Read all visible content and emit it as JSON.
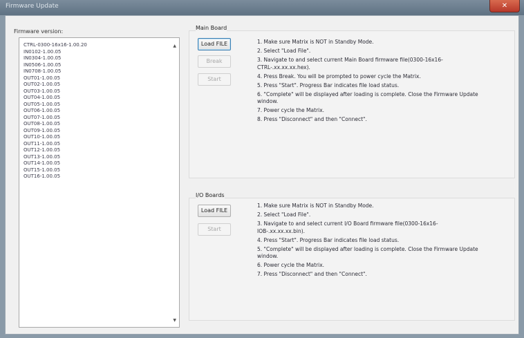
{
  "window": {
    "title": "Firmware Update",
    "close_glyph": "✕"
  },
  "firmware_version": {
    "label": "Firmware version:",
    "items": [
      "CTRL-0300-16x16-1.00.20",
      "IN0102-1.00.05",
      "IN0304-1.00.05",
      "IN0506-1.00.05",
      "IN0708-1.00.05",
      "OUT01-1.00.05",
      "OUT02-1.00.05",
      "OUT03-1.00.05",
      "OUT04-1.00.05",
      "OUT05-1.00.05",
      "OUT06-1.00.05",
      "OUT07-1.00.05",
      "OUT08-1.00.05",
      "OUT09-1.00.05",
      "OUT10-1.00.05",
      "OUT11-1.00.05",
      "OUT12-1.00.05",
      "OUT13-1.00.05",
      "OUT14-1.00.05",
      "OUT15-1.00.05",
      "OUT16-1.00.05"
    ]
  },
  "main_board": {
    "title": "Main Board",
    "load_label": "Load FILE",
    "break_label": "Break",
    "start_label": "Start",
    "steps": [
      "1. Make sure Matrix is NOT in Standby Mode.",
      "2. Select \"Load File\".",
      "3. Navigate to and select current Main Board firmware file(0300-16x16-CTRL-.xx.xx.xx.hex).",
      "4. Press Break. You will be prompted to power cycle the Matrix.",
      "5. Press \"Start\". Progress Bar indicates file load status.",
      "6. \"Complete\" will be displayed after loading is complete. Close the Firmware Update window.",
      "7. Power cycle the Matrix.",
      "8. Press \"Disconnect\" and then \"Connect\"."
    ]
  },
  "io_boards": {
    "title": "I/O Boards",
    "load_label": "Load FILE",
    "start_label": "Start",
    "steps": [
      "1. Make sure Matrix is NOT in Standby Mode.",
      "2. Select \"Load File\".",
      "3. Navigate to and select current I/O Board firmware file(0300-16x16-IOB-.xx.xx.xx.bin).",
      "4. Press \"Start\". Progress Bar indicates file load status.",
      "5. \"Complete\" will be displayed after loading is complete. Close the Firmware Update window.",
      "6. Power cycle the Matrix.",
      "7. Press \"Disconnect\" and then \"Connect\"."
    ]
  }
}
